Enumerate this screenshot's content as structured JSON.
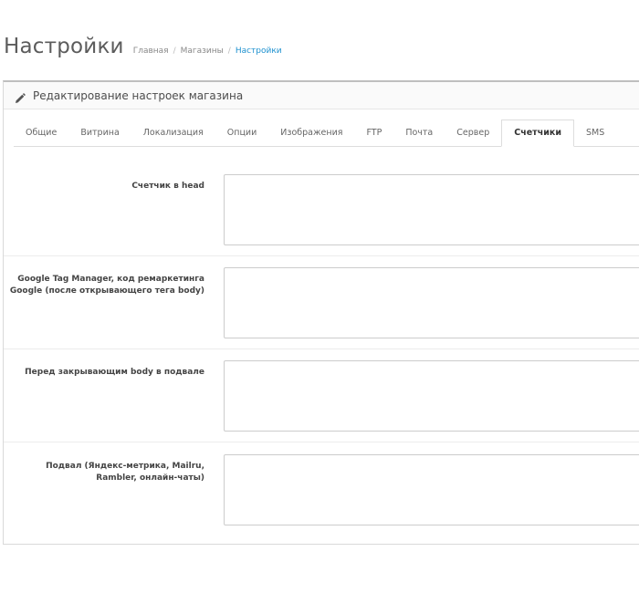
{
  "header": {
    "title": "Настройки",
    "breadcrumb": [
      "Главная",
      "Магазины",
      "Настройки"
    ],
    "separator": "/"
  },
  "panel": {
    "title": "Редактирование настроек магазина",
    "icon": "pencil-icon"
  },
  "tabs": [
    {
      "label": "Общие",
      "active": false
    },
    {
      "label": "Витрина",
      "active": false
    },
    {
      "label": "Локализация",
      "active": false
    },
    {
      "label": "Опции",
      "active": false
    },
    {
      "label": "Изображения",
      "active": false
    },
    {
      "label": "FTP",
      "active": false
    },
    {
      "label": "Почта",
      "active": false
    },
    {
      "label": "Сервер",
      "active": false
    },
    {
      "label": "Счетчики",
      "active": true
    },
    {
      "label": "SMS",
      "active": false
    }
  ],
  "fields": [
    {
      "label": "Счетчик в head",
      "value": ""
    },
    {
      "label": "Google Tag Manager, код ремаркетинга Google (после открывающего тега body)",
      "value": ""
    },
    {
      "label": "Перед закрывающим body в подвале",
      "value": ""
    },
    {
      "label": "Подвал (Яндекс-метрика, Mailru, Rambler, онлайн-чаты)",
      "value": ""
    }
  ],
  "colors": {
    "link": "#1e91cf",
    "border": "#cccccc"
  }
}
